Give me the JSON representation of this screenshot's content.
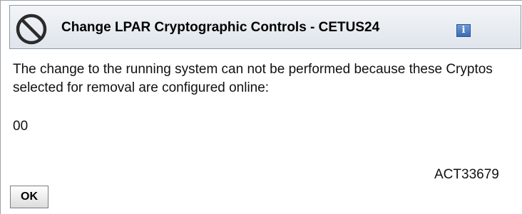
{
  "dialog": {
    "title": "Change LPAR Cryptographic Controls - CETUS24",
    "title_icon": "prohibited-icon",
    "info_icon": "info-icon",
    "info_label": "i",
    "message": "The change to the running system can not be performed because these Cryptos selected for removal are configured online:",
    "crypto_ids": [
      "00"
    ],
    "message_code": "ACT33679",
    "ok_label": "OK"
  }
}
